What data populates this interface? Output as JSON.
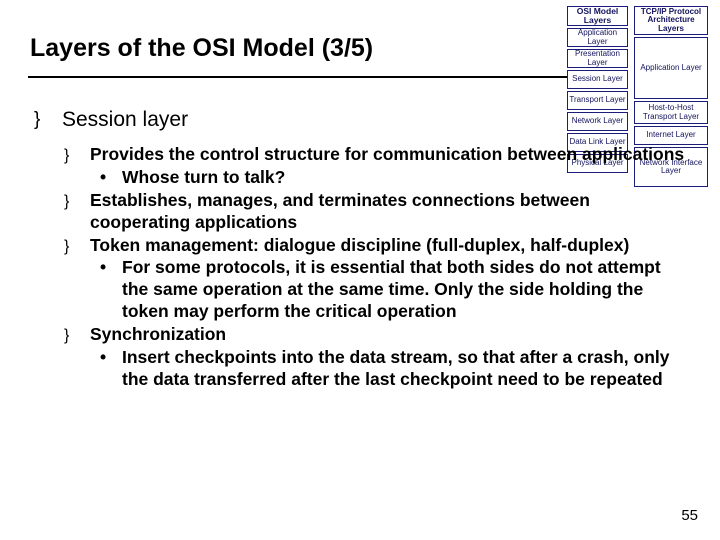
{
  "title": "Layers of the OSI Model (3/5)",
  "page_number": "55",
  "content": {
    "heading": "Session layer",
    "b1": "Provides the control structure for communication between applications",
    "b1a": "Whose turn to talk?",
    "b2": "Establishes, manages, and terminates connections between cooperating applications",
    "b3": "Token management: dialogue discipline (full-duplex, half-duplex)",
    "b3a": "For some protocols, it is essential that both sides do not attempt the same operation at the same time. Only the side holding the token may perform the critical operation",
    "b4": "Synchronization",
    "b4a": "Insert checkpoints into the data stream, so that after a crash, only the data transferred after the last checkpoint need to be repeated"
  },
  "diagram": {
    "osi_header": "OSI Model Layers",
    "tcp_header": "TCP/IP Protocol Architecture Layers",
    "osi": {
      "l7": "Application Layer",
      "l6": "Presentation Layer",
      "l5": "Session Layer",
      "l4": "Transport Layer",
      "l3": "Network Layer",
      "l2": "Data Link Layer",
      "l1": "Physical Layer"
    },
    "tcp": {
      "app": "Application Layer",
      "transport": "Host-to-Host Transport Layer",
      "internet": "Internet Layer",
      "netif": "Network Interface Layer"
    }
  }
}
